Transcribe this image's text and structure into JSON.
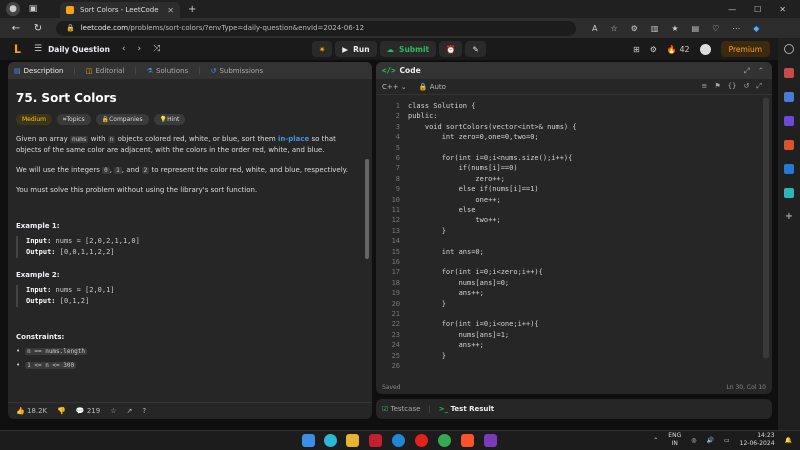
{
  "browser": {
    "tab_title": "Sort Colors - LeetCode",
    "url_host": "leetcode.com",
    "url_path": "/problems/sort-colors/?envType=daily-question&envId=2024-06-12"
  },
  "header": {
    "daily_label": "Daily Question",
    "run_label": "Run",
    "submit_label": "Submit",
    "streak": "42",
    "premium_label": "Premium"
  },
  "left_tabs": [
    "Description",
    "Editorial",
    "Solutions",
    "Submissions"
  ],
  "problem": {
    "title": "75. Sort Colors",
    "badges": [
      "Medium",
      "Topics",
      "Companies",
      "Hint"
    ],
    "desc1_a": "Given an array ",
    "desc1_code1": "nums",
    "desc1_b": " with ",
    "desc1_code2": "n",
    "desc1_c": " objects colored red, white, or blue, sort them ",
    "desc1_link": "in-place",
    "desc1_d": " so that objects of the same color are adjacent, with the colors in the order red, white, and blue.",
    "desc2_a": "We will use the integers ",
    "desc2_c0": "0",
    "desc2_b": ", ",
    "desc2_c1": "1",
    "desc2_c": ", and ",
    "desc2_c2": "2",
    "desc2_d": " to represent the color red, white, and blue, respectively.",
    "desc3": "You must solve this problem without using the library's sort function.",
    "ex1_title": "Example 1:",
    "ex1_input_label": "Input:",
    "ex1_input": "nums = [2,0,2,1,1,0]",
    "ex1_output_label": "Output:",
    "ex1_output": "[0,0,1,1,2,2]",
    "ex2_title": "Example 2:",
    "ex2_input_label": "Input:",
    "ex2_input": "nums = [2,0,1]",
    "ex2_output_label": "Output:",
    "ex2_output": "[0,1,2]",
    "constraints_title": "Constraints:",
    "constraints": [
      "n == nums.length",
      "1 <= n <= 300"
    ]
  },
  "footer_left": {
    "likes": "18.2K",
    "comments": "219"
  },
  "editor": {
    "title": "Code",
    "language": "C++",
    "mode": "Auto",
    "status": "Saved",
    "cursor": "Ln 30, Col 10",
    "lines": [
      "class Solution {",
      "public:",
      "    void sortColors(vector<int>& nums) {",
      "        int zero=0,one=0,two=0;",
      "",
      "        for(int i=0;i<nums.size();i++){",
      "            if(nums[i]==0)",
      "                zero++;",
      "            else if(nums[i]==1)",
      "                one++;",
      "            else",
      "                two++;",
      "        }",
      "",
      "        int ans=0;",
      "",
      "        for(int i=0;i<zero;i++){",
      "            nums[ans]=0;",
      "            ans++;",
      "        }",
      "",
      "        for(int i=0;i<one;i++){",
      "            nums[ans]=1;",
      "            ans++;",
      "        }",
      ""
    ]
  },
  "test_tabs": [
    "Testcase",
    "Test Result"
  ],
  "taskbar": {
    "lang1": "ENG",
    "lang2": "IN",
    "time": "14:23",
    "date": "12-06-2024"
  }
}
